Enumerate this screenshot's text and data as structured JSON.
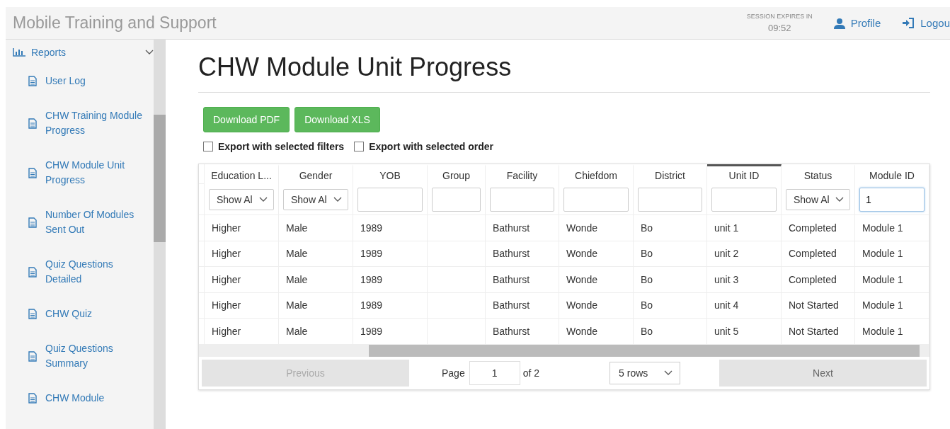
{
  "header": {
    "title": "Mobile Training and Support",
    "session_label": "SESSION EXPIRES IN",
    "session_time": "09:52",
    "links": [
      {
        "label": "Profile",
        "kind": "profile"
      },
      {
        "label": "Logou",
        "kind": "logout"
      }
    ]
  },
  "sidebar": {
    "section": {
      "label": "Reports",
      "expanded": true
    },
    "items": [
      {
        "label": "User Log"
      },
      {
        "label": "CHW Training Module Progress"
      },
      {
        "label": "CHW Module Unit Progress"
      },
      {
        "label": "Number Of Modules Sent Out"
      },
      {
        "label": "Quiz Questions Detailed"
      },
      {
        "label": "CHW Quiz"
      },
      {
        "label": "Quiz Questions Summary"
      },
      {
        "label": "CHW Module"
      }
    ]
  },
  "page_title": "CHW Module Unit Progress",
  "buttons": [
    "Download PDF",
    "Download XLS"
  ],
  "export_options": [
    {
      "label": "Export with selected filters",
      "checked": false
    },
    {
      "label": "Export with selected order",
      "checked": false
    }
  ],
  "table": {
    "columns": [
      {
        "header": "Education L...",
        "sorted": false,
        "filter": {
          "kind": "select",
          "value": "Show Al"
        }
      },
      {
        "header": "Gender",
        "sorted": false,
        "filter": {
          "kind": "select",
          "value": "Show Al"
        }
      },
      {
        "header": "YOB",
        "sorted": false,
        "filter": {
          "kind": "text"
        }
      },
      {
        "header": "Group",
        "sorted": false,
        "filter": {
          "kind": "text"
        }
      },
      {
        "header": "Facility",
        "sorted": false,
        "filter": {
          "kind": "text"
        }
      },
      {
        "header": "Chiefdom",
        "sorted": false,
        "filter": {
          "kind": "text"
        }
      },
      {
        "header": "District",
        "sorted": false,
        "filter": {
          "kind": "text"
        }
      },
      {
        "header": "Unit ID",
        "sorted": true,
        "filter": {
          "kind": "text"
        }
      },
      {
        "header": "Status",
        "sorted": false,
        "filter": {
          "kind": "select",
          "value": "Show Al"
        }
      },
      {
        "header": "Module ID",
        "sorted": false,
        "filter": {
          "kind": "text",
          "value": "1",
          "focused": true
        }
      }
    ],
    "rows": [
      [
        "Higher",
        "Male",
        "1989",
        null,
        "Bathurst",
        "Wonde",
        "Bo",
        "unit 1",
        "Completed",
        "Module 1"
      ],
      [
        "Higher",
        "Male",
        "1989",
        null,
        "Bathurst",
        "Wonde",
        "Bo",
        "unit 2",
        "Completed",
        "Module 1"
      ],
      [
        "Higher",
        "Male",
        "1989",
        null,
        "Bathurst",
        "Wonde",
        "Bo",
        "unit 3",
        "Completed",
        "Module 1"
      ],
      [
        "Higher",
        "Male",
        "1989",
        null,
        "Bathurst",
        "Wonde",
        "Bo",
        "unit 4",
        "Not Started",
        "Module 1"
      ],
      [
        "Higher",
        "Male",
        "1989",
        null,
        "Bathurst",
        "Wonde",
        "Bo",
        "unit 5",
        "Not Started",
        "Module 1"
      ]
    ]
  },
  "pagination": {
    "previous": {
      "label": "Previous",
      "disabled": true
    },
    "page_label": "Page",
    "page": "1",
    "of": "of 2",
    "rows": "5 rows",
    "next": {
      "label": "Next",
      "disabled": false
    }
  }
}
